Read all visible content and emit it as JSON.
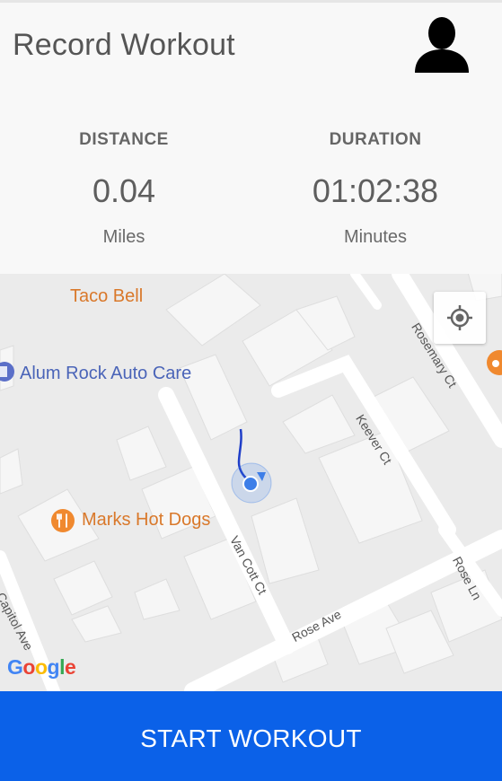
{
  "header": {
    "title": "Record Workout",
    "avatar_icon": "person-silhouette-icon"
  },
  "stats": {
    "distance": {
      "label": "DISTANCE",
      "value": "0.04",
      "unit": "Miles"
    },
    "duration": {
      "label": "DURATION",
      "value": "01:02:38",
      "unit": "Minutes"
    }
  },
  "map": {
    "pois": [
      {
        "name": "Taco Bell",
        "kind": "restaurant"
      },
      {
        "name": "Alum Rock Auto Care",
        "kind": "auto"
      },
      {
        "name": "Marks Hot Dogs",
        "kind": "restaurant"
      }
    ],
    "streets": {
      "rosemary": "Rosemary Ct",
      "keever": "Keever Ct",
      "van_cott": "Van Cott Ct",
      "rose_ave": "Rose Ave",
      "rose_ln": "Rose Ln",
      "capitol": "Capitol Ave"
    },
    "attribution": "Google",
    "locate_icon": "my-location-icon",
    "colors": {
      "route": "#1f3ec8",
      "location_dot": "#3d7ee8",
      "poi_orange": "#f0892f",
      "poi_blue": "#4a64b8"
    }
  },
  "footer": {
    "start_label": "START WORKOUT",
    "color": "#0b61e8"
  }
}
